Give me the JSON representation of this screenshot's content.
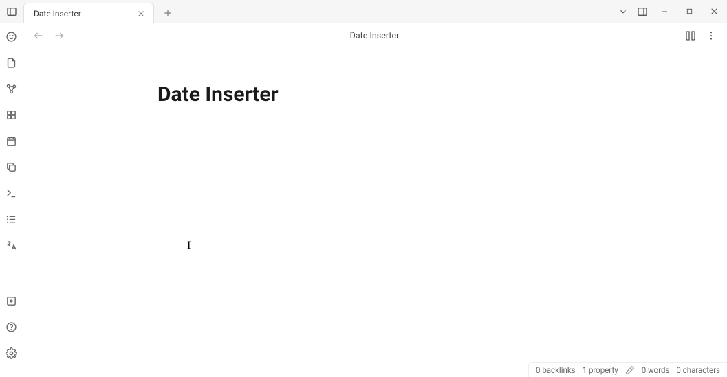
{
  "tab": {
    "title": "Date Inserter"
  },
  "header": {
    "title": "Date Inserter"
  },
  "document": {
    "heading": "Date Inserter"
  },
  "status": {
    "backlinks": "0 backlinks",
    "properties": "1 property",
    "words": "0 words",
    "characters": "0 characters"
  }
}
